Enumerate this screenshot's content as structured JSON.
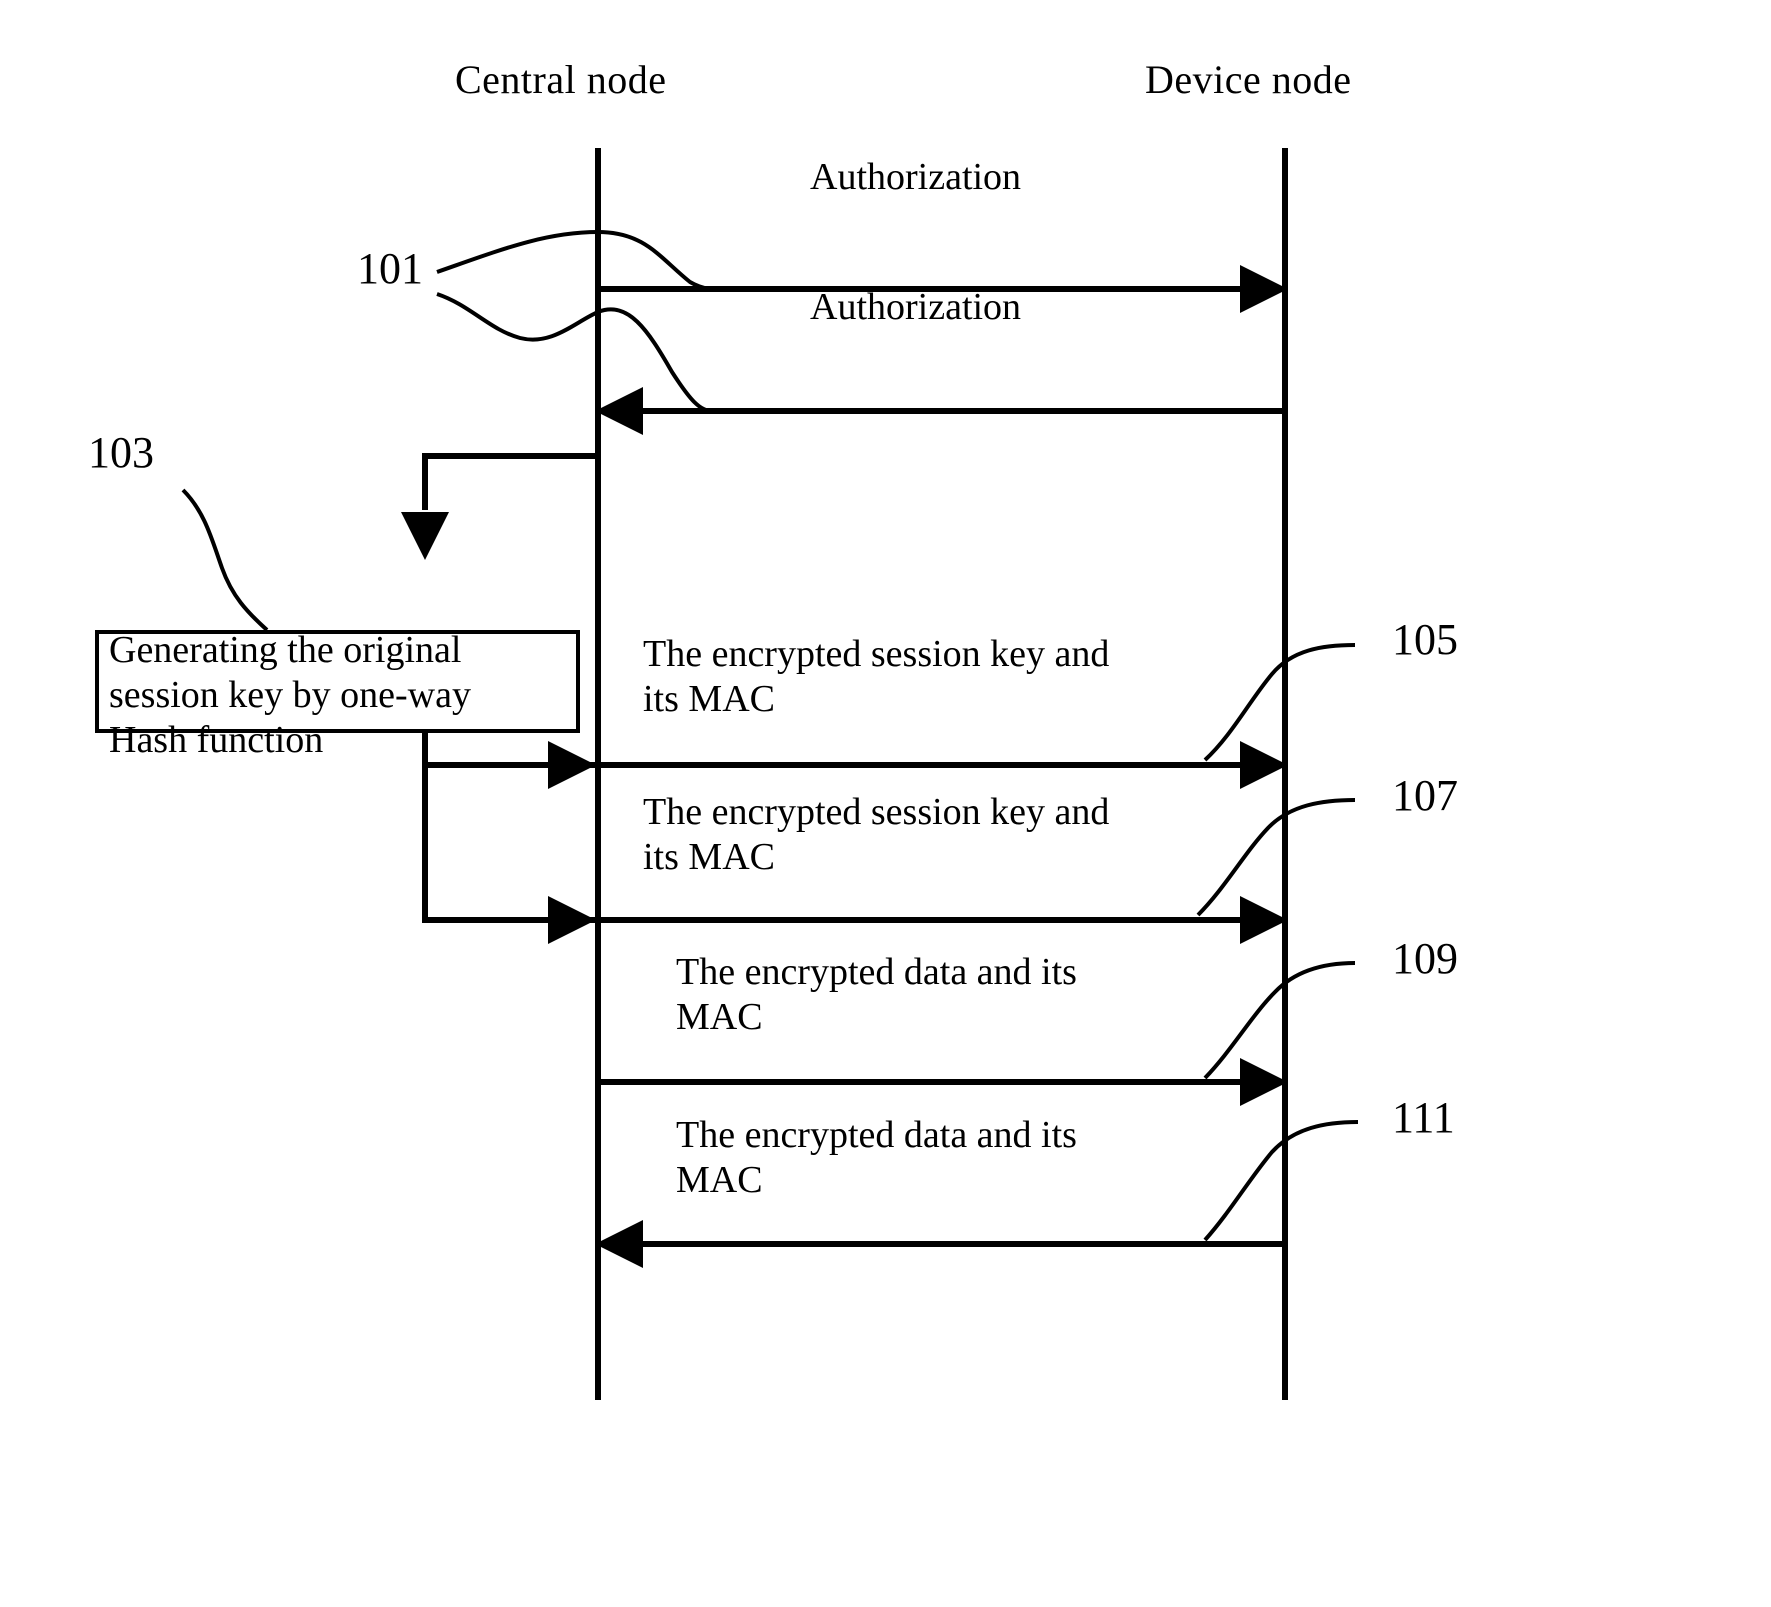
{
  "figure": {
    "type": "sequence-diagram",
    "style": "patent-line-drawing",
    "line_color": "#000000",
    "background": "#ffffff"
  },
  "lifelines": [
    {
      "id": "central",
      "title": "Central node",
      "x_pct": 33.8
    },
    {
      "id": "device",
      "title": "Device node",
      "x_pct": 72.6
    }
  ],
  "reference_numerals": [
    {
      "id": "101",
      "label": "101",
      "targets": [
        "authorization-request",
        "authorization-response"
      ]
    },
    {
      "id": "103",
      "label": "103",
      "targets": [
        "process-box"
      ]
    },
    {
      "id": "105",
      "label": "105",
      "targets": [
        "session-key-msg-1"
      ]
    },
    {
      "id": "107",
      "label": "107",
      "targets": [
        "session-key-msg-2"
      ]
    },
    {
      "id": "109",
      "label": "109",
      "targets": [
        "data-msg-1"
      ]
    },
    {
      "id": "111",
      "label": "111",
      "targets": [
        "data-msg-2"
      ]
    }
  ],
  "process_box": {
    "id": "process-box",
    "text": "Generating the original\nsession key by one-way\nHash function"
  },
  "messages": [
    {
      "id": "authorization-request",
      "label": "Authorization",
      "from": "central",
      "to": "device",
      "direction": "right",
      "ref": "101"
    },
    {
      "id": "authorization-response",
      "label": "Authorization",
      "from": "device",
      "to": "central",
      "direction": "left",
      "ref": "101"
    },
    {
      "id": "session-key-msg-1",
      "label": "The encrypted session key and\nits MAC",
      "from": "central",
      "to": "device",
      "direction": "right",
      "ref": "105"
    },
    {
      "id": "session-key-msg-2",
      "label": "The encrypted session key and\nits MAC",
      "from": "central",
      "to": "device",
      "direction": "right",
      "ref": "107"
    },
    {
      "id": "data-msg-1",
      "label": "The encrypted data and its\nMAC",
      "from": "central",
      "to": "device",
      "direction": "right",
      "ref": "109"
    },
    {
      "id": "data-msg-2",
      "label": "The encrypted data and its\nMAC",
      "from": "device",
      "to": "central",
      "direction": "left",
      "ref": "111"
    }
  ]
}
